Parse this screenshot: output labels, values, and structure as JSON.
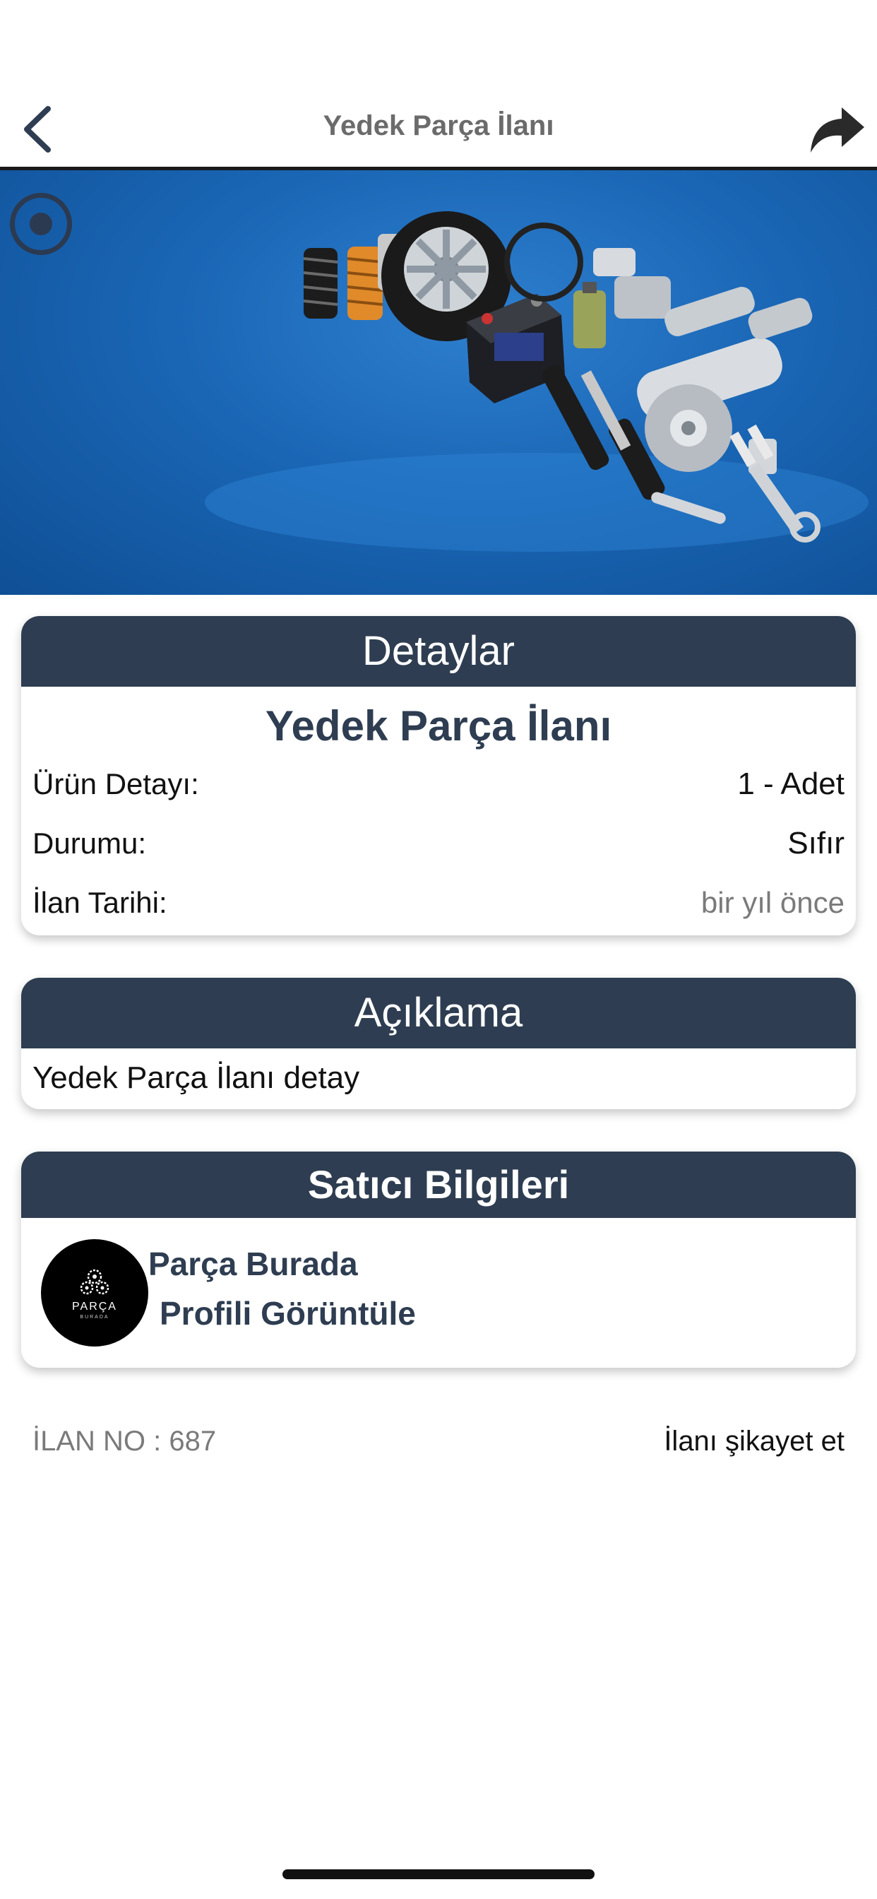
{
  "nav": {
    "title": "Yedek Parça İlanı"
  },
  "details": {
    "header": "Detaylar",
    "title": "Yedek Parça İlanı",
    "rows": [
      {
        "label": "Ürün Detayı:",
        "value": "1 - Adet"
      },
      {
        "label": "Durumu:",
        "value": "Sıfır"
      },
      {
        "label": "İlan Tarihi:",
        "value": "bir yıl önce"
      }
    ]
  },
  "description": {
    "header": "Açıklama",
    "text": "Yedek Parça İlanı detay"
  },
  "seller": {
    "header": "Satıcı Bilgileri",
    "name": "Parça Burada",
    "profile_link": "Profili Görüntüle",
    "avatar_brand": "PARÇA",
    "avatar_brand_sub": "BURADA"
  },
  "footer": {
    "ad_no": "İLAN NO : 687",
    "report": "İlanı şikayet et"
  },
  "colors": {
    "header_bg": "#2e3d51",
    "accent_text": "#2e3d51",
    "banner_blue": "#1a66b5"
  },
  "icons": {
    "back": "chevron-left-icon",
    "share": "share-arrow-icon",
    "slide_indicator": "radio-dot-icon"
  }
}
